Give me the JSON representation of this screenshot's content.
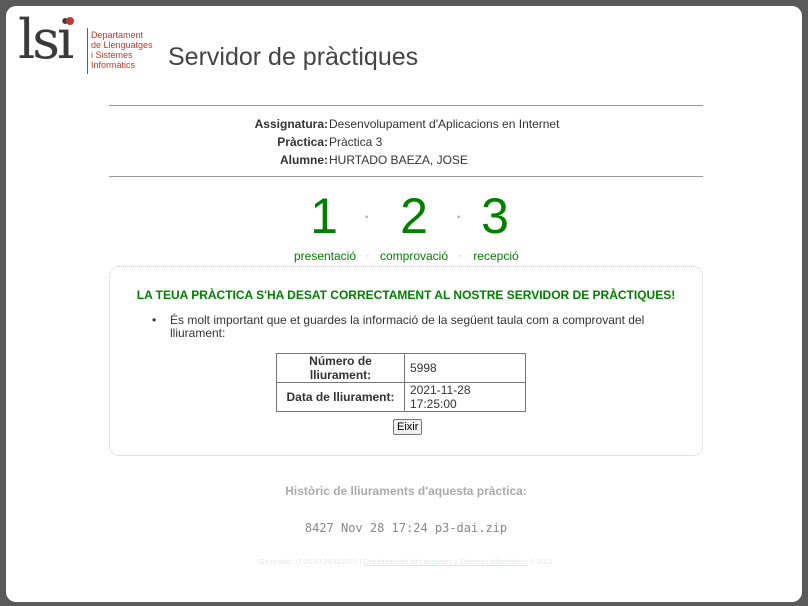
{
  "logo": {
    "mark": "lsi",
    "lines": [
      "Departament",
      "de Llenguatges",
      "i Sistemes",
      "Informàtics"
    ],
    "accent_color": "#c0392b"
  },
  "header": {
    "title": "Servidor de pràctiques"
  },
  "info": {
    "subject_label": "Assignatura:",
    "subject_value": "Desenvolupament d'Aplicacions en Internet",
    "practice_label": "Pràctica:",
    "practice_value": "Pràctica 3",
    "student_label": "Alumne:",
    "student_value": "HURTADO BAEZA, JOSE"
  },
  "steps": {
    "items": [
      {
        "number": "1",
        "label": "presentació"
      },
      {
        "number": "2",
        "label": "comprovació"
      },
      {
        "number": "3",
        "label": "recepció"
      }
    ],
    "separator": "·",
    "color": "#008000"
  },
  "result": {
    "success_message": "LA TEUA PRÀCTICA S'HA DESAT CORRECTAMENT AL NOSTRE SERVIDOR DE PRÀCTIQUES!",
    "bullet": "•",
    "note": "És molt important que et guardes la informació de la següent taula com a comprovant del lliurament:",
    "table": {
      "delivery_number_label": "Número de lliurament:",
      "delivery_number_value": "5998",
      "delivery_date_label": "Data de lliurament:",
      "delivery_date_value": "2021-11-28 17:25:00"
    },
    "exit_label": "Eixir"
  },
  "history": {
    "title": "Històric de lliuraments d'aquesta pràctica:",
    "entries": [
      "8427 Nov 28 17:24 p3-dai.zip"
    ]
  },
  "footer": {
    "generated": "Generado: 17:25:00 28/11/2021",
    "link": "Departamento de Lenguajes y Sistemas Informáticos",
    "copyright": "© 2021"
  }
}
